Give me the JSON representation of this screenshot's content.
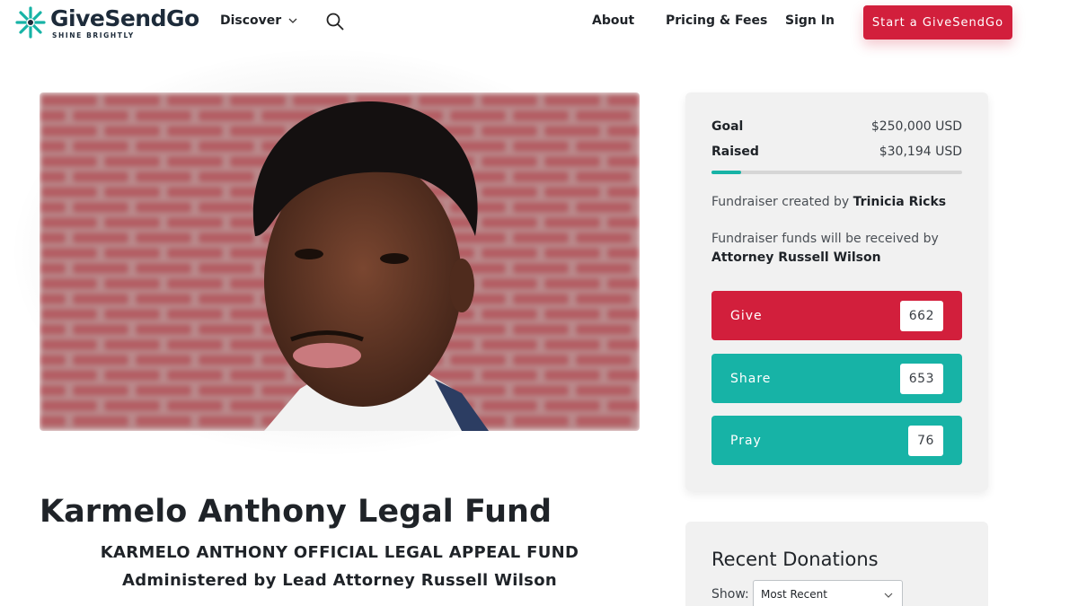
{
  "header": {
    "logo_text": "GiveSendGo",
    "logo_tagline": "SHINE BRIGHTLY",
    "discover_label": "Discover",
    "about_label": "About",
    "pricing_label": "Pricing & Fees",
    "signin_label": "Sign In",
    "start_label": "Start a GiveSendGo"
  },
  "campaign": {
    "title": "Karmelo Anthony Legal Fund",
    "subtitle_1": "KARMELO ANTHONY OFFICIAL LEGAL APPEAL FUND",
    "subtitle_2": "Administered by Lead Attorney Russell Wilson"
  },
  "stats": {
    "goal_label": "Goal",
    "goal_value": "$250,000 USD",
    "raised_label": "Raised",
    "raised_value": "$30,194 USD",
    "progress_fraction": 0.12,
    "created_prefix": "Fundraiser created by",
    "created_by": "Trinicia Ricks",
    "received_prefix": "Fundraiser funds will be received by",
    "received_by": "Attorney Russell Wilson"
  },
  "actions": {
    "give_label": "Give",
    "give_count": "662",
    "share_label": "Share",
    "share_count": "653",
    "pray_label": "Pray",
    "pray_count": "76"
  },
  "donations": {
    "title": "Recent Donations",
    "show_label": "Show:",
    "sort_selected": "Most Recent"
  },
  "colors": {
    "brand_red": "#d21f3c",
    "brand_teal": "#17b3a6"
  }
}
